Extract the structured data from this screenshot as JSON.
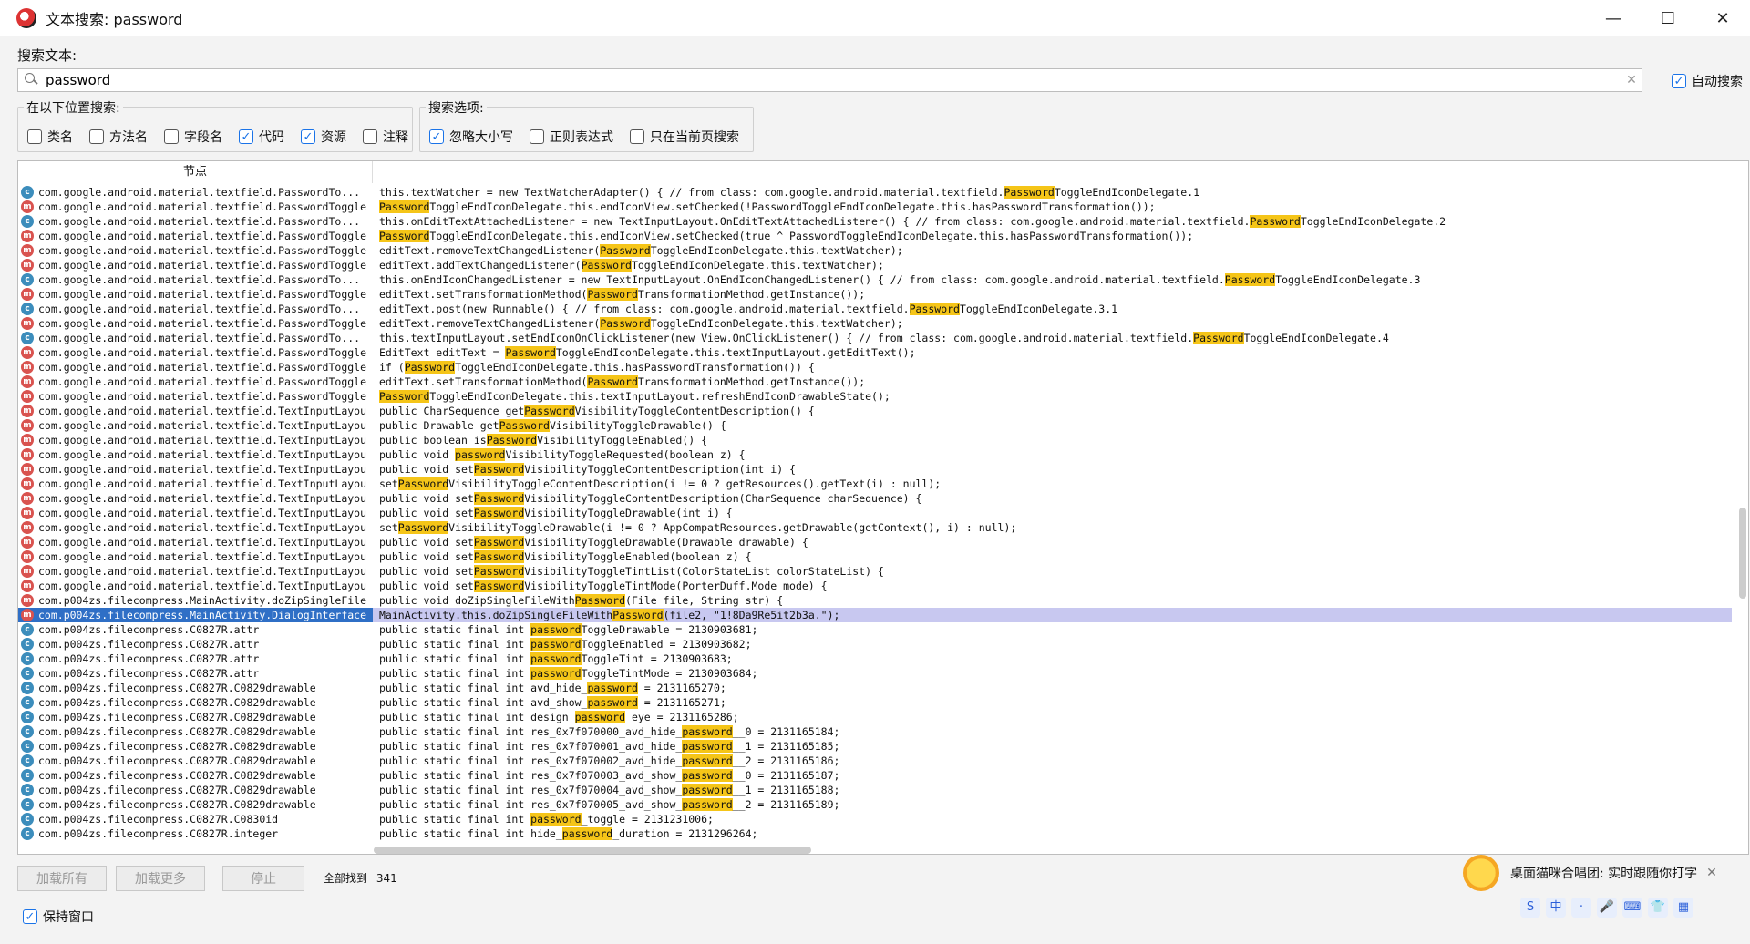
{
  "window": {
    "title": "文本搜索: password",
    "minimize": "—",
    "maximize": "☐",
    "close": "✕"
  },
  "search": {
    "label": "搜索文本:",
    "value": "password",
    "clear": "✕",
    "auto_search_label": "自动搜索"
  },
  "scope": {
    "title": "在以下位置搜索:",
    "options": [
      {
        "label": "类名",
        "checked": false
      },
      {
        "label": "方法名",
        "checked": false
      },
      {
        "label": "字段名",
        "checked": false
      },
      {
        "label": "代码",
        "checked": true
      },
      {
        "label": "资源",
        "checked": true
      },
      {
        "label": "注释",
        "checked": false
      }
    ]
  },
  "options": {
    "title": "搜索选项:",
    "items": [
      {
        "label": "忽略大小写",
        "checked": true
      },
      {
        "label": "正则表达式",
        "checked": false
      },
      {
        "label": "只在当前页搜索",
        "checked": false
      }
    ]
  },
  "table": {
    "node_header": "节点",
    "rows": [
      {
        "type": "c",
        "node": "com.google.android.material.textfield.PasswordTo...",
        "pre": "this.textWatcher = new TextWatcherAdapter() { // from class: com.google.android.material.textfield.",
        "match": "Password",
        "post": "ToggleEndIconDelegate.1"
      },
      {
        "type": "m",
        "node": "com.google.android.material.textfield.PasswordToggle",
        "pre": "",
        "match": "Password",
        "post": "ToggleEndIconDelegate.this.endIconView.setChecked(!PasswordToggleEndIconDelegate.this.hasPasswordTransformation());"
      },
      {
        "type": "c",
        "node": "com.google.android.material.textfield.PasswordTo...",
        "pre": "this.onEditTextAttachedListener = new TextInputLayout.OnEditTextAttachedListener() { // from class: com.google.android.material.textfield.",
        "match": "Password",
        "post": "ToggleEndIconDelegate.2"
      },
      {
        "type": "m",
        "node": "com.google.android.material.textfield.PasswordToggle",
        "pre": "",
        "match": "Password",
        "post": "ToggleEndIconDelegate.this.endIconView.setChecked(true ^ PasswordToggleEndIconDelegate.this.hasPasswordTransformation());"
      },
      {
        "type": "m",
        "node": "com.google.android.material.textfield.PasswordToggle",
        "pre": "editText.removeTextChangedListener(",
        "match": "Password",
        "post": "ToggleEndIconDelegate.this.textWatcher);"
      },
      {
        "type": "m",
        "node": "com.google.android.material.textfield.PasswordToggle",
        "pre": "editText.addTextChangedListener(",
        "match": "Password",
        "post": "ToggleEndIconDelegate.this.textWatcher);"
      },
      {
        "type": "c",
        "node": "com.google.android.material.textfield.PasswordTo...",
        "pre": "this.onEndIconChangedListener = new TextInputLayout.OnEndIconChangedListener() { // from class: com.google.android.material.textfield.",
        "match": "Password",
        "post": "ToggleEndIconDelegate.3"
      },
      {
        "type": "m",
        "node": "com.google.android.material.textfield.PasswordToggle",
        "pre": "editText.setTransformationMethod(",
        "match": "Password",
        "post": "TransformationMethod.getInstance());"
      },
      {
        "type": "c",
        "node": "com.google.android.material.textfield.PasswordTo...",
        "pre": "editText.post(new Runnable() { // from class: com.google.android.material.textfield.",
        "match": "Password",
        "post": "ToggleEndIconDelegate.3.1"
      },
      {
        "type": "m",
        "node": "com.google.android.material.textfield.PasswordToggle",
        "pre": "editText.removeTextChangedListener(",
        "match": "Password",
        "post": "ToggleEndIconDelegate.this.textWatcher);"
      },
      {
        "type": "c",
        "node": "com.google.android.material.textfield.PasswordTo...",
        "pre": "this.textInputLayout.setEndIconOnClickListener(new View.OnClickListener() { // from class: com.google.android.material.textfield.",
        "match": "Password",
        "post": "ToggleEndIconDelegate.4"
      },
      {
        "type": "m",
        "node": "com.google.android.material.textfield.PasswordToggle",
        "pre": "EditText editText = ",
        "match": "Password",
        "post": "ToggleEndIconDelegate.this.textInputLayout.getEditText();"
      },
      {
        "type": "m",
        "node": "com.google.android.material.textfield.PasswordToggle",
        "pre": "if (",
        "match": "Password",
        "post": "ToggleEndIconDelegate.this.hasPasswordTransformation()) {"
      },
      {
        "type": "m",
        "node": "com.google.android.material.textfield.PasswordToggle",
        "pre": "editText.setTransformationMethod(",
        "match": "Password",
        "post": "TransformationMethod.getInstance());"
      },
      {
        "type": "m",
        "node": "com.google.android.material.textfield.PasswordToggle",
        "pre": "",
        "match": "Password",
        "post": "ToggleEndIconDelegate.this.textInputLayout.refreshEndIconDrawableState();"
      },
      {
        "type": "m",
        "node": "com.google.android.material.textfield.TextInputLayou",
        "pre": "public CharSequence get",
        "match": "Password",
        "post": "VisibilityToggleContentDescription() {"
      },
      {
        "type": "m",
        "node": "com.google.android.material.textfield.TextInputLayou",
        "pre": "public Drawable get",
        "match": "Password",
        "post": "VisibilityToggleDrawable() {"
      },
      {
        "type": "m",
        "node": "com.google.android.material.textfield.TextInputLayou",
        "pre": "public boolean is",
        "match": "Password",
        "post": "VisibilityToggleEnabled() {"
      },
      {
        "type": "m",
        "node": "com.google.android.material.textfield.TextInputLayou",
        "pre": "public void ",
        "match": "password",
        "post": "VisibilityToggleRequested(boolean z) {"
      },
      {
        "type": "m",
        "node": "com.google.android.material.textfield.TextInputLayou",
        "pre": "public void set",
        "match": "Password",
        "post": "VisibilityToggleContentDescription(int i) {"
      },
      {
        "type": "m",
        "node": "com.google.android.material.textfield.TextInputLayou",
        "pre": "set",
        "match": "Password",
        "post": "VisibilityToggleContentDescription(i != 0 ? getResources().getText(i) : null);"
      },
      {
        "type": "m",
        "node": "com.google.android.material.textfield.TextInputLayou",
        "pre": "public void set",
        "match": "Password",
        "post": "VisibilityToggleContentDescription(CharSequence charSequence) {"
      },
      {
        "type": "m",
        "node": "com.google.android.material.textfield.TextInputLayou",
        "pre": "public void set",
        "match": "Password",
        "post": "VisibilityToggleDrawable(int i) {"
      },
      {
        "type": "m",
        "node": "com.google.android.material.textfield.TextInputLayou",
        "pre": "set",
        "match": "Password",
        "post": "VisibilityToggleDrawable(i != 0 ? AppCompatResources.getDrawable(getContext(), i) : null);"
      },
      {
        "type": "m",
        "node": "com.google.android.material.textfield.TextInputLayou",
        "pre": "public void set",
        "match": "Password",
        "post": "VisibilityToggleDrawable(Drawable drawable) {"
      },
      {
        "type": "m",
        "node": "com.google.android.material.textfield.TextInputLayou",
        "pre": "public void set",
        "match": "Password",
        "post": "VisibilityToggleEnabled(boolean z) {"
      },
      {
        "type": "m",
        "node": "com.google.android.material.textfield.TextInputLayou",
        "pre": "public void set",
        "match": "Password",
        "post": "VisibilityToggleTintList(ColorStateList colorStateList) {"
      },
      {
        "type": "m",
        "node": "com.google.android.material.textfield.TextInputLayou",
        "pre": "public void set",
        "match": "Password",
        "post": "VisibilityToggleTintMode(PorterDuff.Mode mode) {"
      },
      {
        "type": "m",
        "node": "com.p004zs.filecompress.MainActivity.doZipSingleFile",
        "pre": "public void doZipSingleFileWith",
        "match": "Password",
        "post": "(File file, String str) {"
      },
      {
        "type": "m",
        "node": "com.p004zs.filecompress.MainActivity.DialogInterface",
        "pre": "MainActivity.this.doZipSingleFileWith",
        "match": "Password",
        "post": "(file2, \"1!8Da9Re5it2b3a.\");",
        "selected": true
      },
      {
        "type": "c",
        "node": "com.p004zs.filecompress.C0827R.attr",
        "pre": "public static final int ",
        "match": "password",
        "post": "ToggleDrawable = 2130903681;"
      },
      {
        "type": "c",
        "node": "com.p004zs.filecompress.C0827R.attr",
        "pre": "public static final int ",
        "match": "password",
        "post": "ToggleEnabled = 2130903682;"
      },
      {
        "type": "c",
        "node": "com.p004zs.filecompress.C0827R.attr",
        "pre": "public static final int ",
        "match": "password",
        "post": "ToggleTint = 2130903683;"
      },
      {
        "type": "c",
        "node": "com.p004zs.filecompress.C0827R.attr",
        "pre": "public static final int ",
        "match": "password",
        "post": "ToggleTintMode = 2130903684;"
      },
      {
        "type": "c",
        "node": "com.p004zs.filecompress.C0827R.C0829drawable",
        "pre": "public static final int avd_hide_",
        "match": "password",
        "post": " = 2131165270;"
      },
      {
        "type": "c",
        "node": "com.p004zs.filecompress.C0827R.C0829drawable",
        "pre": "public static final int avd_show_",
        "match": "password",
        "post": " = 2131165271;"
      },
      {
        "type": "c",
        "node": "com.p004zs.filecompress.C0827R.C0829drawable",
        "pre": "public static final int design_",
        "match": "password",
        "post": "_eye = 2131165286;"
      },
      {
        "type": "c",
        "node": "com.p004zs.filecompress.C0827R.C0829drawable",
        "pre": "public static final int res_0x7f070000_avd_hide_",
        "match": "password",
        "post": "__0 = 2131165184;"
      },
      {
        "type": "c",
        "node": "com.p004zs.filecompress.C0827R.C0829drawable",
        "pre": "public static final int res_0x7f070001_avd_hide_",
        "match": "password",
        "post": "__1 = 2131165185;"
      },
      {
        "type": "c",
        "node": "com.p004zs.filecompress.C0827R.C0829drawable",
        "pre": "public static final int res_0x7f070002_avd_hide_",
        "match": "password",
        "post": "__2 = 2131165186;"
      },
      {
        "type": "c",
        "node": "com.p004zs.filecompress.C0827R.C0829drawable",
        "pre": "public static final int res_0x7f070003_avd_show_",
        "match": "password",
        "post": "__0 = 2131165187;"
      },
      {
        "type": "c",
        "node": "com.p004zs.filecompress.C0827R.C0829drawable",
        "pre": "public static final int res_0x7f070004_avd_show_",
        "match": "password",
        "post": "__1 = 2131165188;"
      },
      {
        "type": "c",
        "node": "com.p004zs.filecompress.C0827R.C0829drawable",
        "pre": "public static final int res_0x7f070005_avd_show_",
        "match": "password",
        "post": "__2 = 2131165189;"
      },
      {
        "type": "c",
        "node": "com.p004zs.filecompress.C0827R.C0830id",
        "pre": "public static final int ",
        "match": "password",
        "post": "_toggle = 2131231006;"
      },
      {
        "type": "c",
        "node": "com.p004zs.filecompress.C0827R.integer",
        "pre": "public static final int hide_",
        "match": "password",
        "post": "_duration = 2131296264;"
      }
    ]
  },
  "footer": {
    "load_all": "加载所有",
    "load_more": "加载更多",
    "stop": "停止",
    "found_label": "全部找到",
    "found_count": "341",
    "keep_window": "保持窗口"
  },
  "toast": {
    "text": "桌面猫咪合唱团: 实时跟随你打字",
    "close": "✕"
  },
  "ime": [
    "S",
    "中",
    "·",
    "🎤",
    "⌨",
    "👕",
    "▦"
  ]
}
